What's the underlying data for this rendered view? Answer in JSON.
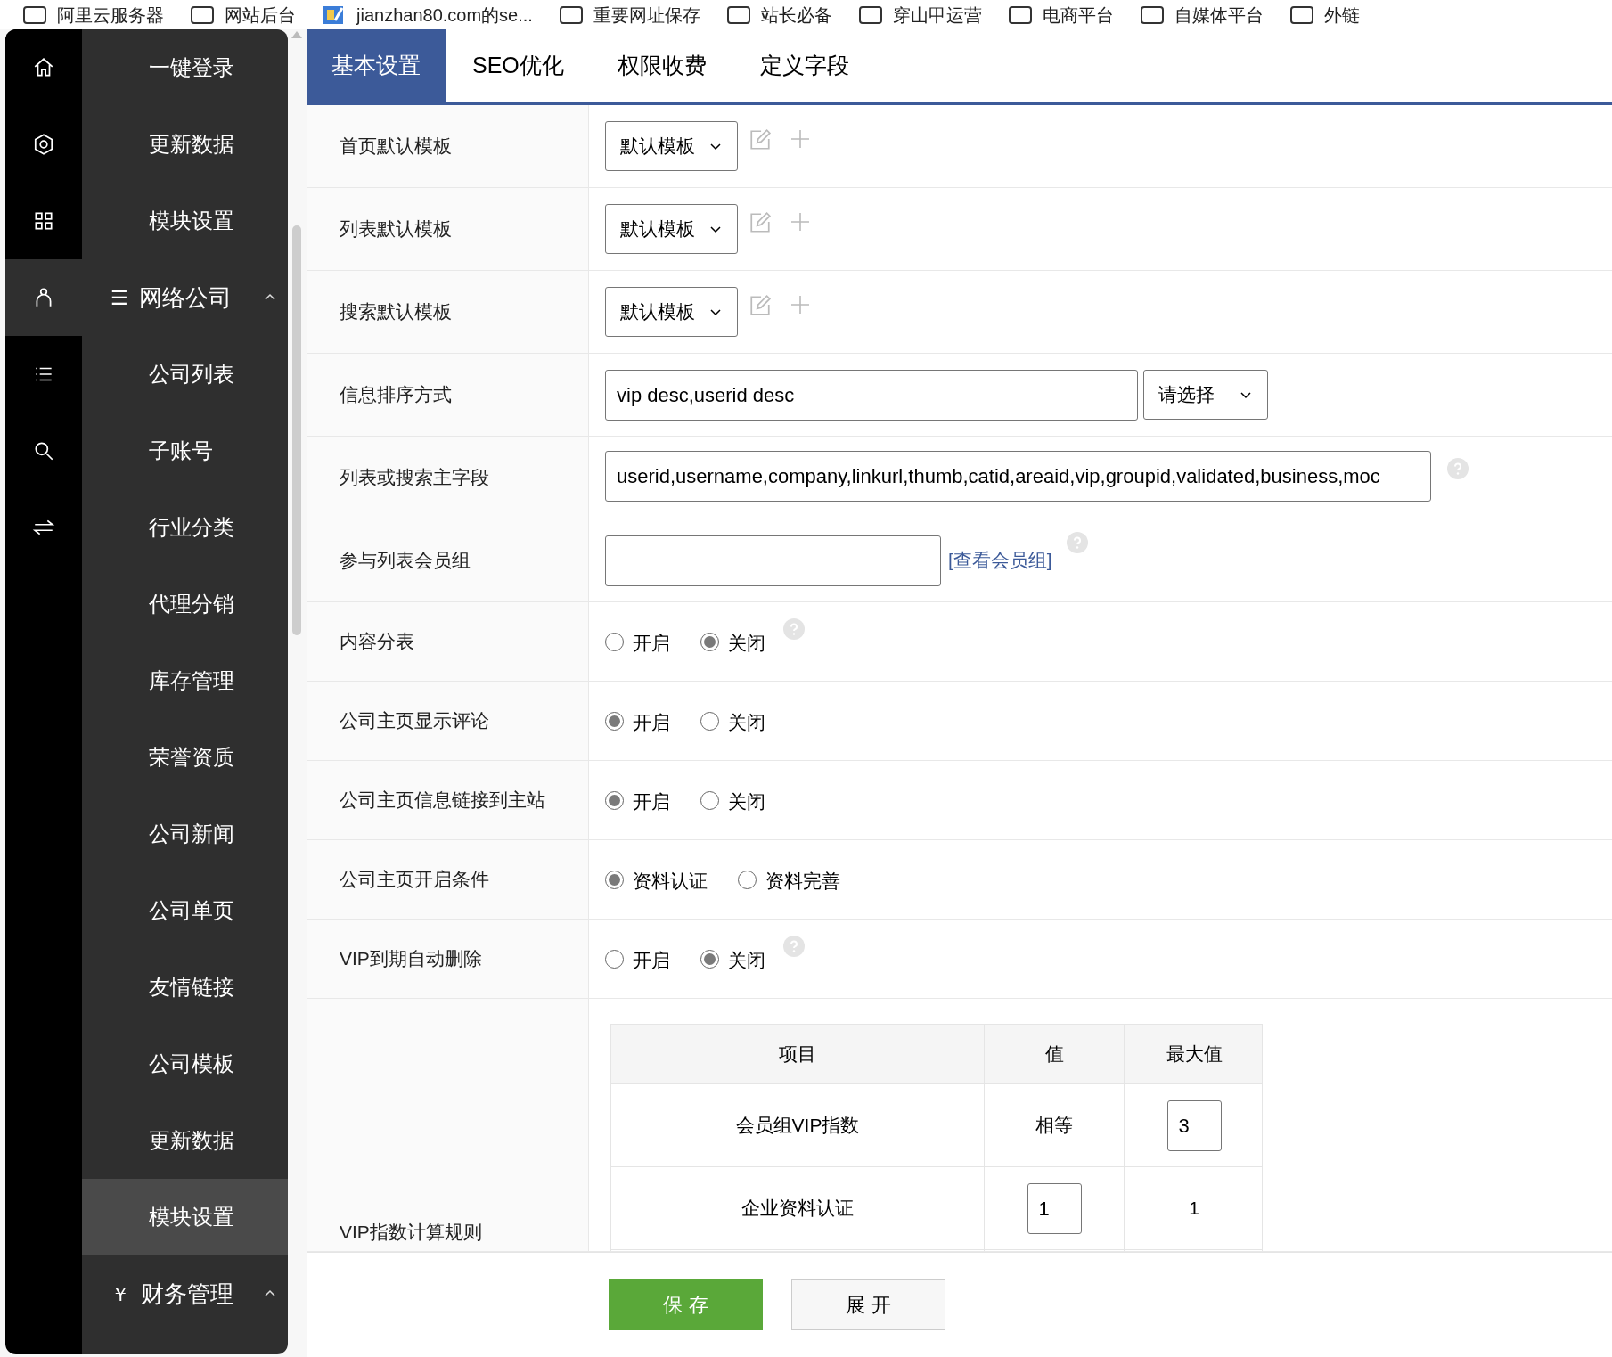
{
  "bookmarks": [
    {
      "kind": "folder",
      "label": "阿里云服务器"
    },
    {
      "kind": "folder",
      "label": "网站后台"
    },
    {
      "kind": "page",
      "label": "jianzhan80.com的se..."
    },
    {
      "kind": "folder",
      "label": "重要网址保存"
    },
    {
      "kind": "folder",
      "label": "站长必备"
    },
    {
      "kind": "folder",
      "label": "穿山甲运营"
    },
    {
      "kind": "folder",
      "label": "电商平台"
    },
    {
      "kind": "folder",
      "label": "自媒体平台"
    },
    {
      "kind": "folder",
      "label": "外链"
    }
  ],
  "rail": [
    {
      "selected": false
    },
    {
      "selected": false
    },
    {
      "selected": false
    },
    {
      "selected": true
    },
    {
      "selected": false
    },
    {
      "selected": false
    },
    {
      "selected": false
    }
  ],
  "menu": [
    {
      "kind": "item",
      "label": "一键登录",
      "selected": false
    },
    {
      "kind": "item",
      "label": "更新数据",
      "selected": false
    },
    {
      "kind": "item",
      "label": "模块设置",
      "selected": false
    },
    {
      "kind": "group",
      "label": "网络公司",
      "symbol": "☰",
      "expanded": true,
      "children": [
        {
          "label": "公司列表",
          "selected": false
        },
        {
          "label": "子账号",
          "selected": false
        },
        {
          "label": "行业分类",
          "selected": false
        },
        {
          "label": "代理分销",
          "selected": false
        },
        {
          "label": "库存管理",
          "selected": false
        },
        {
          "label": "荣誉资质",
          "selected": false
        },
        {
          "label": "公司新闻",
          "selected": false
        },
        {
          "label": "公司单页",
          "selected": false
        },
        {
          "label": "友情链接",
          "selected": false
        },
        {
          "label": "公司模板",
          "selected": false
        },
        {
          "label": "更新数据",
          "selected": false
        },
        {
          "label": "模块设置",
          "selected": true
        }
      ]
    },
    {
      "kind": "group",
      "label": "财务管理",
      "symbol": "￥",
      "expanded": true
    }
  ],
  "tabs": [
    {
      "label": "基本设置",
      "selected": true
    },
    {
      "label": "SEO优化",
      "selected": false
    },
    {
      "label": "权限收费",
      "selected": false
    },
    {
      "label": "定义字段",
      "selected": false
    }
  ],
  "rows": [
    {
      "kind": "template",
      "label": "首页默认模板",
      "value": "默认模板"
    },
    {
      "kind": "template",
      "label": "列表默认模板",
      "value": "默认模板"
    },
    {
      "kind": "template",
      "label": "搜索默认模板",
      "value": "默认模板"
    },
    {
      "kind": "text_select",
      "label": "信息排序方式",
      "value": "vip desc,userid desc",
      "select": "请选择"
    },
    {
      "kind": "text",
      "label": "列表或搜索主字段",
      "value": "userid,username,company,linkurl,thumb,catid,areaid,vip,groupid,validated,business,moc",
      "help": true
    },
    {
      "kind": "text_link",
      "label": "参与列表会员组",
      "link": "[查看会员组]",
      "help": true
    },
    {
      "kind": "radio",
      "label": "内容分表",
      "help": true,
      "options": [
        {
          "label": "开启",
          "selected": false
        },
        {
          "label": "关闭",
          "selected": true
        }
      ]
    },
    {
      "kind": "radio",
      "label": "公司主页显示评论",
      "help": false,
      "options": [
        {
          "label": "开启",
          "selected": true
        },
        {
          "label": "关闭",
          "selected": false
        }
      ]
    },
    {
      "kind": "radio",
      "label": "公司主页信息链接到主站",
      "help": false,
      "options": [
        {
          "label": "开启",
          "selected": true
        },
        {
          "label": "关闭",
          "selected": false
        }
      ]
    },
    {
      "kind": "radio",
      "label": "公司主页开启条件",
      "help": false,
      "options": [
        {
          "label": "资料认证",
          "selected": true
        },
        {
          "label": "资料完善",
          "selected": false
        }
      ]
    },
    {
      "kind": "radio",
      "label": "VIP到期自动删除",
      "help": true,
      "options": [
        {
          "label": "开启",
          "selected": false
        },
        {
          "label": "关闭",
          "selected": true
        }
      ]
    },
    {
      "kind": "table",
      "label": "VIP指数计算规则",
      "columns": [
        "项目",
        "值",
        "最大值"
      ],
      "table_rows": [
        [
          {
            "kind": "text",
            "text": "会员组VIP指数"
          },
          {
            "kind": "text",
            "text": "相等"
          },
          {
            "kind": "input",
            "text": "3"
          }
        ],
        [
          {
            "kind": "text",
            "text": "企业资料认证"
          },
          {
            "kind": "input",
            "text": "1"
          },
          {
            "kind": "text",
            "text": "1"
          }
        ]
      ]
    }
  ],
  "buttons": [
    {
      "kind": "primary",
      "label": "保 存"
    },
    {
      "kind": "default",
      "label": "展 开"
    }
  ]
}
